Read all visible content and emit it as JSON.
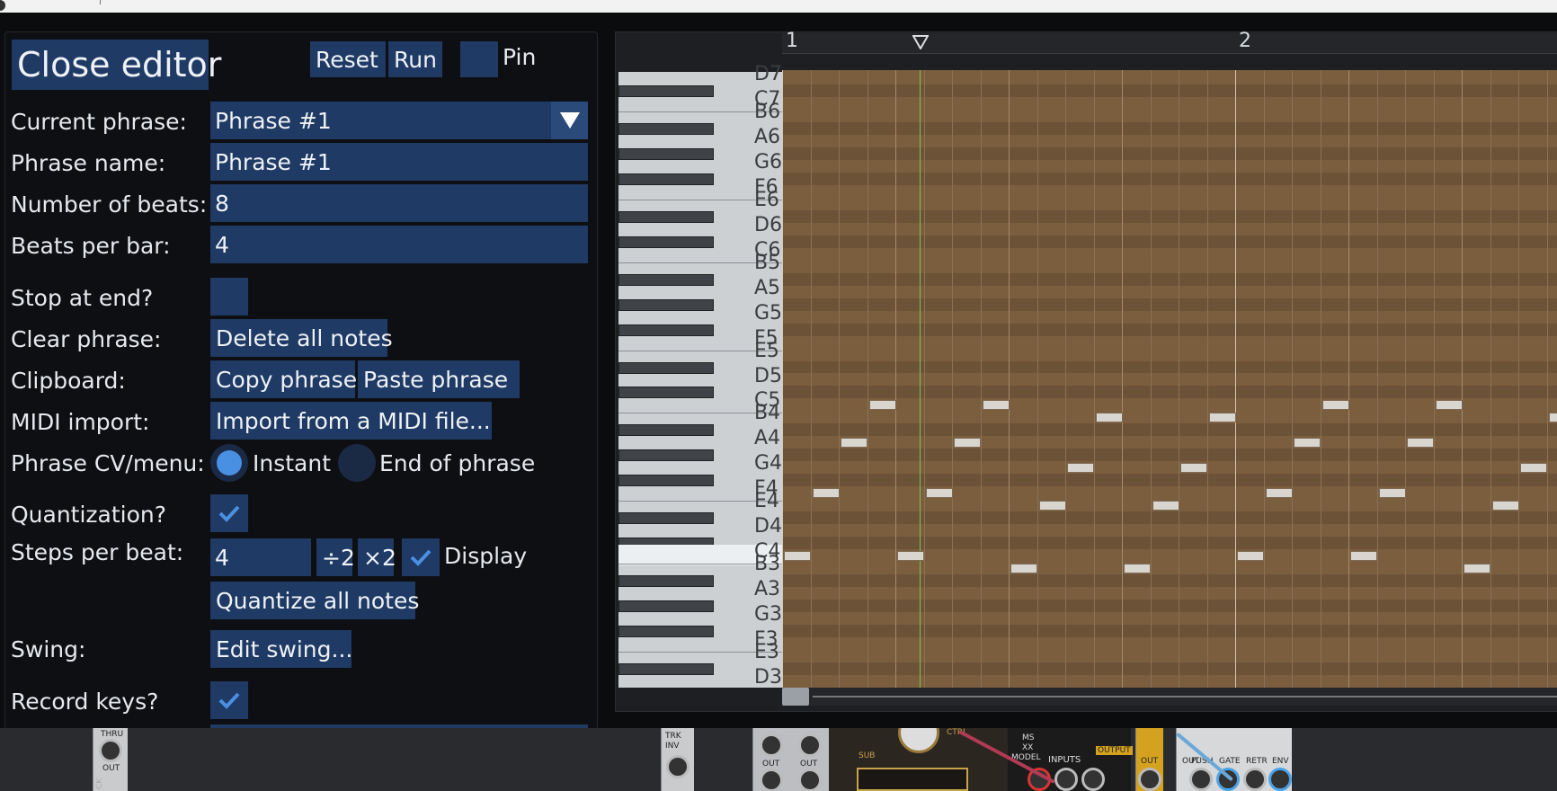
{
  "editor": {
    "close_label": "Close editor",
    "reset_label": "Reset",
    "run_label": "Run",
    "pin_label": "Pin",
    "rows": {
      "current_phrase_label": "Current phrase:",
      "current_phrase_value": "Phrase #1",
      "phrase_name_label": "Phrase name:",
      "phrase_name_value": "Phrase #1",
      "beats_label": "Number of beats:",
      "beats_value": "8",
      "beats_per_bar_label": "Beats per bar:",
      "beats_per_bar_value": "4",
      "stop_label": "Stop at end?",
      "clear_label": "Clear phrase:",
      "delete_all_label": "Delete all notes",
      "clipboard_label": "Clipboard:",
      "copy_label": "Copy phrase",
      "paste_label": "Paste phrase",
      "midi_label": "MIDI import:",
      "midi_button": "Import from a MIDI file...",
      "cv_label": "Phrase CV/menu:",
      "instant_label": "Instant",
      "end_label": "End of phrase",
      "quant_label": "Quantization?",
      "steps_label": "Steps per beat:",
      "steps_value": "4",
      "div2_label": "÷2",
      "mul2_label": "×2",
      "display_label": "Display",
      "quantize_all_label": "Quantize all notes",
      "swing_label": "Swing:",
      "edit_swing_label": "Edit swing...",
      "record_label": "Record keys?"
    },
    "state": {
      "stop_at_end": false,
      "quantization": true,
      "display": true,
      "record_keys": true,
      "phrase_cv_mode": "Instant"
    }
  },
  "roll": {
    "bar_numbers": [
      "1",
      "2"
    ],
    "key_labels": [
      "D7",
      "C7",
      "B6",
      "A6",
      "G6",
      "F6",
      "E6",
      "D6",
      "C6",
      "B5",
      "A5",
      "G5",
      "F5",
      "E5",
      "D5",
      "C5",
      "B4",
      "A4",
      "G4",
      "F4",
      "E4",
      "D4",
      "C4",
      "B3",
      "A3",
      "G3",
      "F3",
      "E3",
      "D3"
    ],
    "highlighted_key": "C4"
  },
  "rack": {
    "labels": [
      "THRU",
      "OUT",
      "TRK",
      "INV",
      "OUT",
      "OUT",
      "OUT",
      "SUB",
      "CTRL",
      "MS",
      "XX",
      "MODEL",
      "INPUTS",
      "OUTPUT",
      "OUT",
      "PUSH",
      "GATE",
      "RETR",
      "ENV",
      "CK"
    ]
  },
  "colors": {
    "button_blue": "#1f3a64",
    "accent": "#4a90e2",
    "grid_brown": "#7a5e3e",
    "playhead": "#7fc44a"
  }
}
